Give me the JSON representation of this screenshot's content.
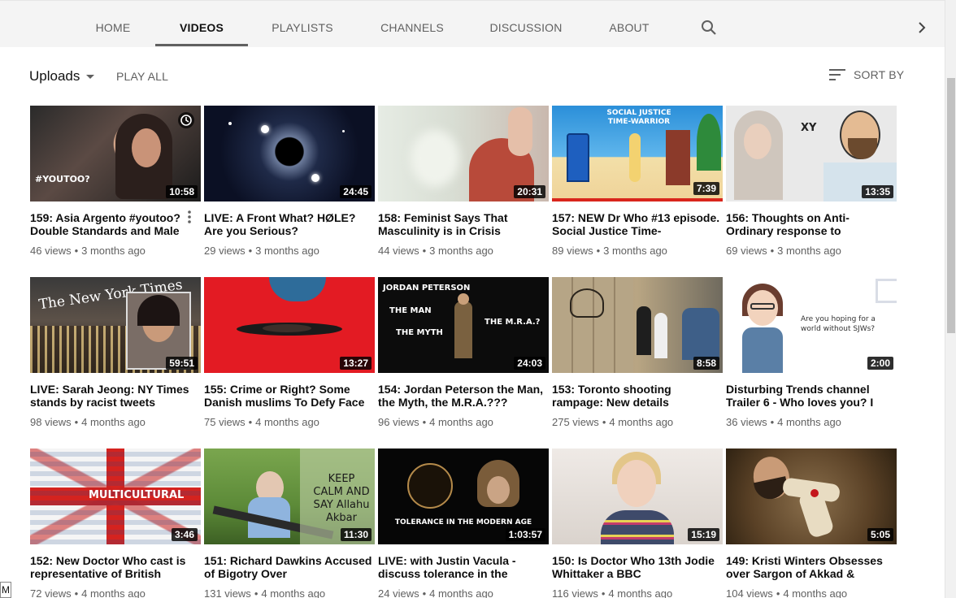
{
  "tabs": [
    {
      "label": "HOME"
    },
    {
      "label": "VIDEOS"
    },
    {
      "label": "PLAYLISTS"
    },
    {
      "label": "CHANNELS"
    },
    {
      "label": "DISCUSSION"
    },
    {
      "label": "ABOUT"
    }
  ],
  "controls": {
    "uploads_label": "Uploads",
    "play_all_label": "PLAY ALL",
    "sort_by_label": "SORT BY"
  },
  "videos": [
    {
      "title": "159: Asia Argento #youtoo? Double Standards and Male",
      "views": "46 views",
      "age": "3 months ago",
      "duration": "10:58",
      "overlay": "#YOUTOO?"
    },
    {
      "title": "LIVE: A Front What? HØLE? Are you Serious?",
      "views": "29 views",
      "age": "3 months ago",
      "duration": "24:45"
    },
    {
      "title": "158: Feminist Says That Masculinity is in Crisis",
      "views": "44 views",
      "age": "3 months ago",
      "duration": "20:31"
    },
    {
      "title": "157: NEW Dr Who #13 episode. Social Justice Time-",
      "views": "89 views",
      "age": "3 months ago",
      "duration": "7:39",
      "overlay": "SOCIAL JUSTICE TIME-WARRIOR"
    },
    {
      "title": "156: Thoughts on Anti-Ordinary response to",
      "views": "69 views",
      "age": "3 months ago",
      "duration": "13:35",
      "overlay": "XY"
    },
    {
      "title": "LIVE: Sarah Jeong: NY Times stands by racist tweets",
      "views": "98 views",
      "age": "4 months ago",
      "duration": "59:51",
      "overlay": "The New York Times"
    },
    {
      "title": "155: Crime or Right? Some Danish muslims To Defy Face",
      "views": "75 views",
      "age": "4 months ago",
      "duration": "13:27"
    },
    {
      "title": "154: Jordan Peterson the Man, the Myth, the M.R.A.???",
      "views": "96 views",
      "age": "4 months ago",
      "duration": "24:03",
      "overlay": "JORDAN PETERSON",
      "overlay2": "THE MAN",
      "overlay3": "THE MYTH",
      "overlay4": "THE M.R.A.?"
    },
    {
      "title": "153: Toronto shooting rampage: New details",
      "views": "275 views",
      "age": "4 months ago",
      "duration": "8:58"
    },
    {
      "title": "Disturbing Trends channel Trailer 6 - Who loves you? I",
      "views": "36 views",
      "age": "4 months ago",
      "duration": "2:00",
      "overlay": "Are you hoping for a world without SJWs?"
    },
    {
      "title": "152: New Doctor Who cast is representative of British",
      "views": "72 views",
      "age": "4 months ago",
      "duration": "3:46",
      "overlay": "MULTICULTURAL"
    },
    {
      "title": "151: Richard Dawkins Accused of Bigotry Over",
      "views": "131 views",
      "age": "4 months ago",
      "duration": "11:30",
      "overlay": "KEEP CALM AND SAY Allahu Akbar"
    },
    {
      "title": "LIVE: with Justin Vacula - discuss tolerance in the",
      "views": "24 views",
      "age": "4 months ago",
      "duration": "1:03:57",
      "overlay": "TOLERANCE IN THE MODERN AGE"
    },
    {
      "title": "150: Is Doctor Who 13th Jodie Whittaker a BBC",
      "views": "116 views",
      "age": "4 months ago",
      "duration": "15:19"
    },
    {
      "title": "149: Kristi Winters Obsesses over Sargon of Akkad &",
      "views": "104 views",
      "age": "4 months ago",
      "duration": "5:05"
    }
  ],
  "corner_label": "M"
}
